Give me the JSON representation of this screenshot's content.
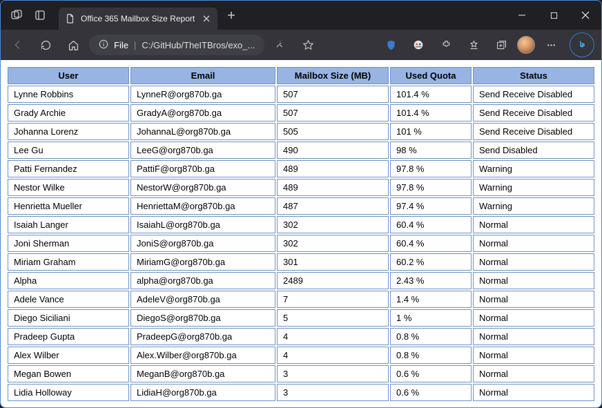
{
  "window": {
    "tab_title": "Office 365 Mailbox Size Report",
    "file_label": "File",
    "path": "C:/GitHub/TheITBros/exo_..."
  },
  "table": {
    "headers": {
      "user": "User",
      "email": "Email",
      "size": "Mailbox Size (MB)",
      "quota": "Used Quota",
      "status": "Status"
    },
    "rows": [
      {
        "user": "Lynne Robbins",
        "email": "LynneR@org870b.ga",
        "size": "507",
        "quota": "101.4 %",
        "status": "Send Receive Disabled"
      },
      {
        "user": "Grady Archie",
        "email": "GradyA@org870b.ga",
        "size": "507",
        "quota": "101.4 %",
        "status": "Send Receive Disabled"
      },
      {
        "user": "Johanna Lorenz",
        "email": "JohannaL@org870b.ga",
        "size": "505",
        "quota": "101 %",
        "status": "Send Receive Disabled"
      },
      {
        "user": "Lee Gu",
        "email": "LeeG@org870b.ga",
        "size": "490",
        "quota": "98 %",
        "status": "Send Disabled"
      },
      {
        "user": "Patti Fernandez",
        "email": "PattiF@org870b.ga",
        "size": "489",
        "quota": "97.8 %",
        "status": "Warning"
      },
      {
        "user": "Nestor Wilke",
        "email": "NestorW@org870b.ga",
        "size": "489",
        "quota": "97.8 %",
        "status": "Warning"
      },
      {
        "user": "Henrietta Mueller",
        "email": "HenriettaM@org870b.ga",
        "size": "487",
        "quota": "97.4 %",
        "status": "Warning"
      },
      {
        "user": "Isaiah Langer",
        "email": "IsaiahL@org870b.ga",
        "size": "302",
        "quota": "60.4 %",
        "status": "Normal"
      },
      {
        "user": "Joni Sherman",
        "email": "JoniS@org870b.ga",
        "size": "302",
        "quota": "60.4 %",
        "status": "Normal"
      },
      {
        "user": "Miriam Graham",
        "email": "MiriamG@org870b.ga",
        "size": "301",
        "quota": "60.2 %",
        "status": "Normal"
      },
      {
        "user": "Alpha",
        "email": "alpha@org870b.ga",
        "size": "2489",
        "quota": "2.43 %",
        "status": "Normal"
      },
      {
        "user": "Adele Vance",
        "email": "AdeleV@org870b.ga",
        "size": "7",
        "quota": "1.4 %",
        "status": "Normal"
      },
      {
        "user": "Diego Siciliani",
        "email": "DiegoS@org870b.ga",
        "size": "5",
        "quota": "1 %",
        "status": "Normal"
      },
      {
        "user": "Pradeep Gupta",
        "email": "PradeepG@org870b.ga",
        "size": "4",
        "quota": "0.8 %",
        "status": "Normal"
      },
      {
        "user": "Alex Wilber",
        "email": "Alex.Wilber@org870b.ga",
        "size": "4",
        "quota": "0.8 %",
        "status": "Normal"
      },
      {
        "user": "Megan Bowen",
        "email": "MeganB@org870b.ga",
        "size": "3",
        "quota": "0.6 %",
        "status": "Normal"
      },
      {
        "user": "Lidia Holloway",
        "email": "LidiaH@org870b.ga",
        "size": "3",
        "quota": "0.6 %",
        "status": "Normal"
      }
    ]
  }
}
